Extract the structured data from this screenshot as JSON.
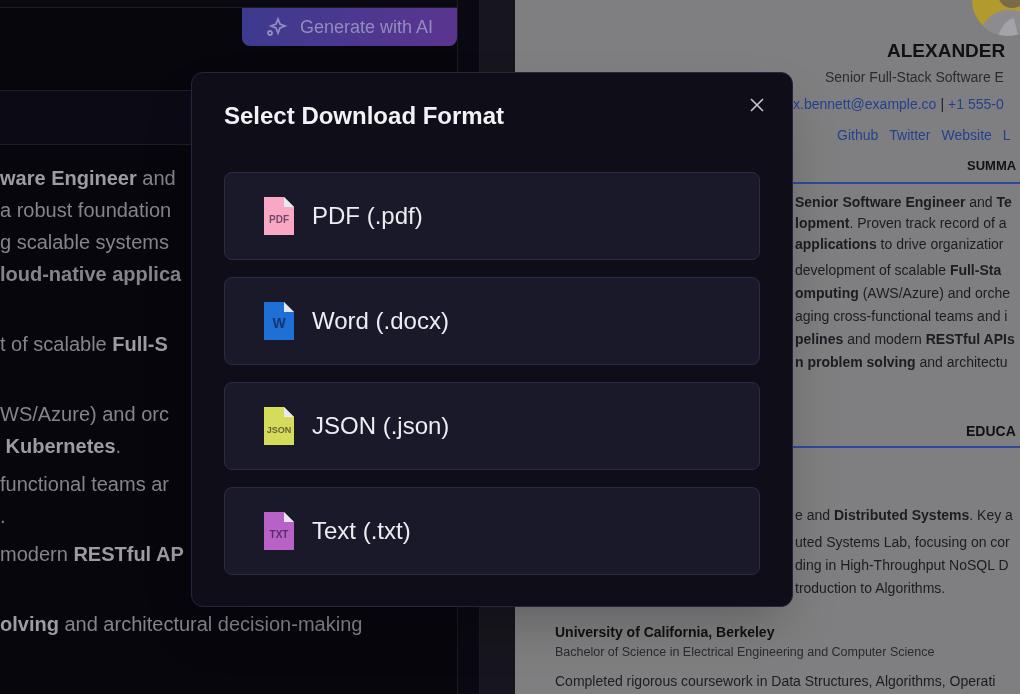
{
  "toolbar": {
    "generate_button": "Generate with AI"
  },
  "editor_paragraphs": [
    [
      {
        "text": "**ware Engineer** and"
      },
      {
        "text": "a robust foundation"
      },
      {
        "text": "g scalable systems"
      },
      {
        "text": "loud-native applica",
        "kind": "bold"
      }
    ],
    [
      {
        "text": "t of scalable **Full-S**"
      }
    ],
    [
      {
        "text": "WS/Azure) and orc"
      },
      {
        "text": " **Kubernetes**."
      }
    ],
    [
      {
        "text": "functional teams ar"
      },
      {
        "text": "."
      }
    ],
    [
      {
        "text": "modern **RESTful AP**"
      }
    ],
    [
      {
        "text": "**olving** and architectural decision-making"
      }
    ]
  ],
  "resume": {
    "name": "ALEXANDER",
    "headline": "Senior Full-Stack Software E",
    "contact": [
      {
        "text": "x.bennett@example.co",
        "kind": "link"
      },
      {
        "text": "|",
        "kind": "plain"
      },
      {
        "text": "+1 555-0",
        "kind": "link"
      }
    ],
    "profile_links": [
      "Github",
      "Twitter",
      "Website",
      "L"
    ],
    "summary": {
      "heading": "SUMMA",
      "lines": [
        "**Senior Software Engineer** and **Te**",
        "**lopment**. Proven track record of a",
        "**applications** to drive organizatior"
      ],
      "bullets": [
        "development of scalable **Full-Sta**",
        "**omputing** (AWS/Azure) and orche",
        "aging cross-functional teams and i",
        "**pelines** and modern **RESTful APIs**",
        "**n problem solving** and architectu"
      ]
    },
    "education": {
      "heading": "EDUCA",
      "entries": [
        {
          "lines": [
            "e and **Distributed Systems**. Key a",
            "uted Systems Lab, focusing on cor",
            "ding in High-Throughput NoSQL D",
            "troduction to Algorithms."
          ]
        },
        {
          "school": "University of California, Berkeley",
          "degree": "Bachelor of Science in Electrical Engineering and Computer Science",
          "lines": [
            "Completed rigorous coursework in Data Structures, Algorithms, Operati"
          ]
        }
      ]
    }
  },
  "dialog": {
    "title": "Select Download Format",
    "options": [
      {
        "label": "PDF (.pdf)",
        "badge": "PDF",
        "color": "#f9a8c4"
      },
      {
        "label": "Word (.docx)",
        "badge": "W",
        "color": "#1e6fd6"
      },
      {
        "label": "JSON (.json)",
        "badge": "JSON",
        "color": "#d4dc5a"
      },
      {
        "label": "Text (.txt)",
        "badge": "TXT",
        "color": "#b862c8"
      }
    ]
  }
}
